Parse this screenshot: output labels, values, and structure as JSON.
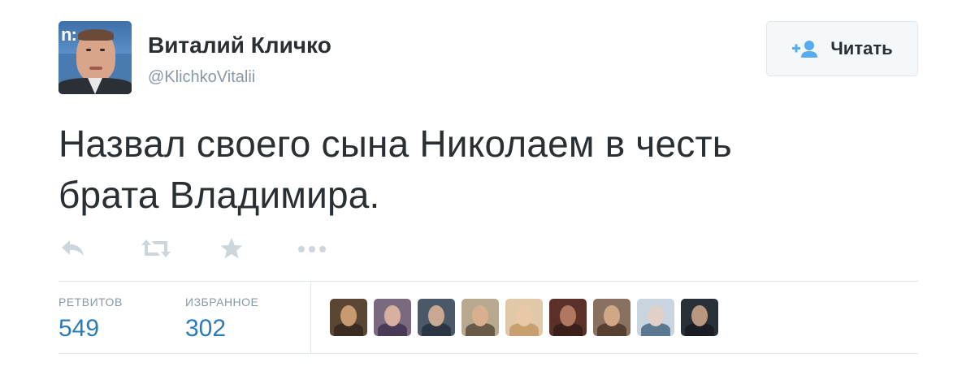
{
  "author": {
    "display_name": "Виталий Кличко",
    "handle": "@KlichkoVitalii",
    "avatar_sign_text": "n:"
  },
  "follow_button": {
    "label": "Читать",
    "icon": "follow-person-plus-icon"
  },
  "tweet": {
    "text_line1": "Назвал своего сына Николаем в честь",
    "text_line2": "брата Владимира."
  },
  "actions": [
    {
      "name": "reply",
      "icon": "reply-icon"
    },
    {
      "name": "retweet",
      "icon": "retweet-icon"
    },
    {
      "name": "favorite",
      "icon": "star-icon"
    },
    {
      "name": "more",
      "icon": "more-dots-icon"
    }
  ],
  "stats": {
    "retweets_label": "РЕТВИТОВ",
    "retweets_value": "549",
    "favorites_label": "ИЗБРАННОЕ",
    "favorites_value": "302"
  },
  "favorited_by": [
    {
      "bg": "#5a4632",
      "face": "#c89a70",
      "body": "#3a2c20"
    },
    {
      "bg": "#7a6a80",
      "face": "#d8b0a0",
      "body": "#4a3a58"
    },
    {
      "bg": "#4a5868",
      "face": "#c8a890",
      "body": "#2a3644"
    },
    {
      "bg": "#b8a890",
      "face": "#d8b090",
      "body": "#6a5a48"
    },
    {
      "bg": "#e0c8a8",
      "face": "#e8c8a8",
      "body": "#c8a070"
    },
    {
      "bg": "#5a3028",
      "face": "#b07860",
      "body": "#3a2018"
    },
    {
      "bg": "#8a7060",
      "face": "#d0a888",
      "body": "#584030"
    },
    {
      "bg": "#c8d4e0",
      "face": "#e0d0c8",
      "body": "#5a7890"
    },
    {
      "bg": "#2a3038",
      "face": "#b89880",
      "body": "#1a1e24"
    }
  ],
  "colors": {
    "text": "#292f33",
    "muted": "#8899a6",
    "link": "#2b7bb9",
    "icon": "#ccd6dd",
    "border": "#e1e8ed",
    "follow_icon": "#55acee"
  }
}
